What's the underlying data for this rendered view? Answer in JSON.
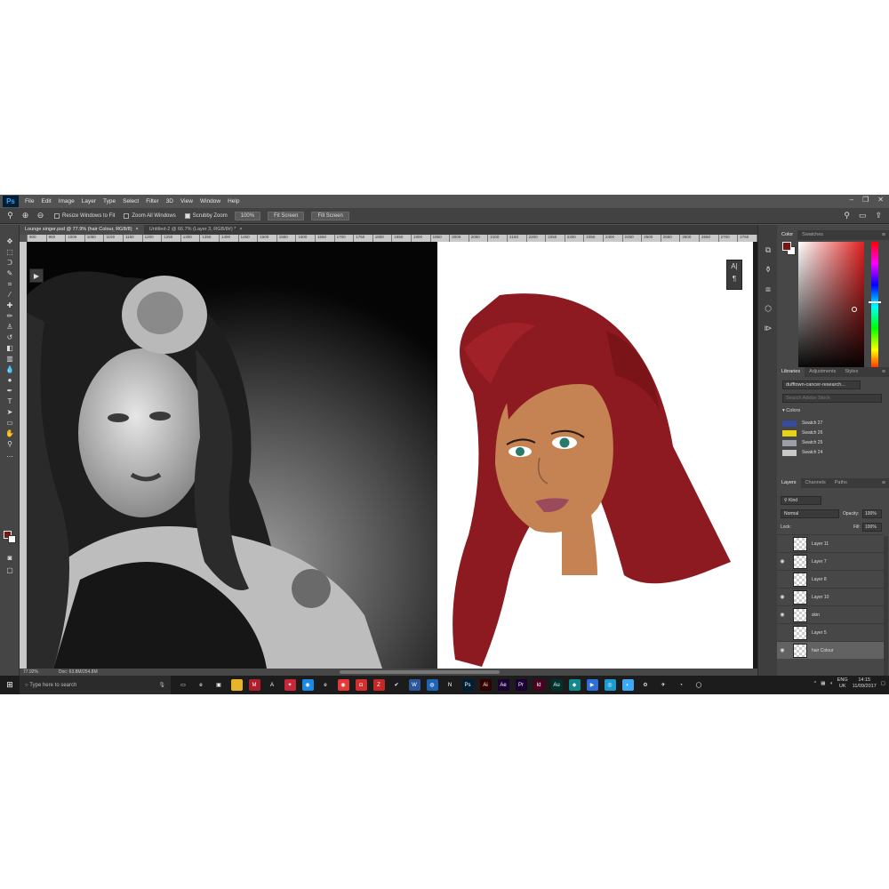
{
  "menubar": {
    "logo": "Ps",
    "items": [
      "File",
      "Edit",
      "Image",
      "Layer",
      "Type",
      "Select",
      "Filter",
      "3D",
      "View",
      "Window",
      "Help"
    ]
  },
  "options": {
    "resize_windows": "Resize Windows to Fit",
    "zoom_all": "Zoom All Windows",
    "scrubby": "Scrubby Zoom",
    "zoom_pct": "100%",
    "fit_screen": "Fit Screen",
    "fill_screen": "Fill Screen"
  },
  "tabs": [
    {
      "label": "Lounge singer.psd @ 77.9% (hair Colour, RGB/8)",
      "close": "×"
    },
    {
      "label": "Untitled-2 @ 66.7% (Layer 3, RGB/8#) *",
      "close": "×"
    }
  ],
  "ruler_ticks": [
    "900",
    "950",
    "1000",
    "1050",
    "1100",
    "1150",
    "1200",
    "1250",
    "1300",
    "1350",
    "1400",
    "1450",
    "1500",
    "1550",
    "1600",
    "1650",
    "1700",
    "1750",
    "1800",
    "1850",
    "1900",
    "1950",
    "2000",
    "2050",
    "2100",
    "2150",
    "2200",
    "2250",
    "2300",
    "2350",
    "2400",
    "2450",
    "2500",
    "2550",
    "2600",
    "2650",
    "2700",
    "2750",
    "2800"
  ],
  "status": {
    "zoom": "77.92%",
    "doc": "Doc: 63.8M/254.8M"
  },
  "color_panel": {
    "tabs": [
      "Color",
      "Swatches"
    ],
    "fg": "#7a1515",
    "bg": "#ffffff"
  },
  "libraries": {
    "tabs": [
      "Libraries",
      "Adjustments",
      "Styles"
    ],
    "library_name": "dufftown-cancer-research...",
    "search_placeholder": "Search Adobe Stock",
    "colors_heading": "Colors",
    "swatches": [
      {
        "name": "Swatch 27",
        "color": "#3a4a9a"
      },
      {
        "name": "Swatch 26",
        "color": "#e8d21a"
      },
      {
        "name": "Swatch 25",
        "color": "#9aa0a6"
      },
      {
        "name": "Swatch 24",
        "color": "#c8c8c8"
      }
    ]
  },
  "layers": {
    "tabs": [
      "Layers",
      "Channels",
      "Paths"
    ],
    "kind": "Kind",
    "blend": "Normal",
    "opacity_label": "Opacity:",
    "opacity": "100%",
    "lock_label": "Lock:",
    "fill_label": "Fill:",
    "fill": "100%",
    "items": [
      {
        "name": "Layer 11",
        "visible": false
      },
      {
        "name": "Layer 7",
        "visible": true
      },
      {
        "name": "Layer 8",
        "visible": false
      },
      {
        "name": "Layer 10",
        "visible": true
      },
      {
        "name": "skin",
        "visible": true
      },
      {
        "name": "Layer 5",
        "visible": false
      },
      {
        "name": "hair Colour",
        "visible": true,
        "selected": true
      }
    ]
  },
  "taskbar": {
    "search_placeholder": "Type here to search",
    "lang_top": "ENG",
    "lang_bottom": "UK",
    "time": "14:15",
    "date": "11/09/2017",
    "apps": [
      {
        "icon": "task-view-icon",
        "color": "#1c1c1c",
        "glyph": "▭"
      },
      {
        "icon": "edge-icon",
        "color": "#1c1c1c",
        "glyph": "e"
      },
      {
        "icon": "store-icon",
        "color": "#1c1c1c",
        "glyph": "▣"
      },
      {
        "icon": "explorer-icon",
        "color": "#e8b42a",
        "glyph": ""
      },
      {
        "icon": "app-m-icon",
        "color": "#b01e2e",
        "glyph": "M"
      },
      {
        "icon": "app-a-icon",
        "color": "#1c1c1c",
        "glyph": "A"
      },
      {
        "icon": "app-x-icon",
        "color": "#c8283a",
        "glyph": "✦"
      },
      {
        "icon": "chrome-like-icon",
        "color": "#1e88e5",
        "glyph": "◉"
      },
      {
        "icon": "ie-icon",
        "color": "#1c1c1c",
        "glyph": "e"
      },
      {
        "icon": "chrome-icon",
        "color": "#e53935",
        "glyph": "◉"
      },
      {
        "icon": "screen-icon",
        "color": "#d32f2f",
        "glyph": "◘"
      },
      {
        "icon": "filezilla-icon",
        "color": "#c62828",
        "glyph": "Z"
      },
      {
        "icon": "check-icon",
        "color": "#1c1c1c",
        "glyph": "✔"
      },
      {
        "icon": "word-icon",
        "color": "#2b579a",
        "glyph": "W"
      },
      {
        "icon": "globe-icon",
        "color": "#1e63b5",
        "glyph": "◍"
      },
      {
        "icon": "netflix-icon",
        "color": "#1c1c1c",
        "glyph": "N"
      },
      {
        "icon": "photoshop-icon",
        "color": "#001e36",
        "glyph": "Ps"
      },
      {
        "icon": "illustrator-icon",
        "color": "#330000",
        "glyph": "Ai"
      },
      {
        "icon": "aftereffects-icon",
        "color": "#1a0033",
        "glyph": "Ae"
      },
      {
        "icon": "premiere-icon",
        "color": "#1a0033",
        "glyph": "Pr"
      },
      {
        "icon": "indesign-icon",
        "color": "#49021f",
        "glyph": "Id"
      },
      {
        "icon": "audition-icon",
        "color": "#00332e",
        "glyph": "Au"
      },
      {
        "icon": "app-teal-icon",
        "color": "#0f8b8d",
        "glyph": "◆"
      },
      {
        "icon": "app-blue-icon",
        "color": "#2d6fd6",
        "glyph": "▶"
      },
      {
        "icon": "app-cyan-icon",
        "color": "#1d9bd1",
        "glyph": "◎"
      },
      {
        "icon": "app-sky-icon",
        "color": "#3fa9f5",
        "glyph": "◐"
      },
      {
        "icon": "settings-icon",
        "color": "#1c1c1c",
        "glyph": "⚙"
      },
      {
        "icon": "app-bird-icon",
        "color": "#1c1c1c",
        "glyph": "✈"
      },
      {
        "icon": "blender-icon",
        "color": "#1c1c1c",
        "glyph": "◔"
      },
      {
        "icon": "app-white-icon",
        "color": "#1c1c1c",
        "glyph": "◯"
      }
    ]
  }
}
